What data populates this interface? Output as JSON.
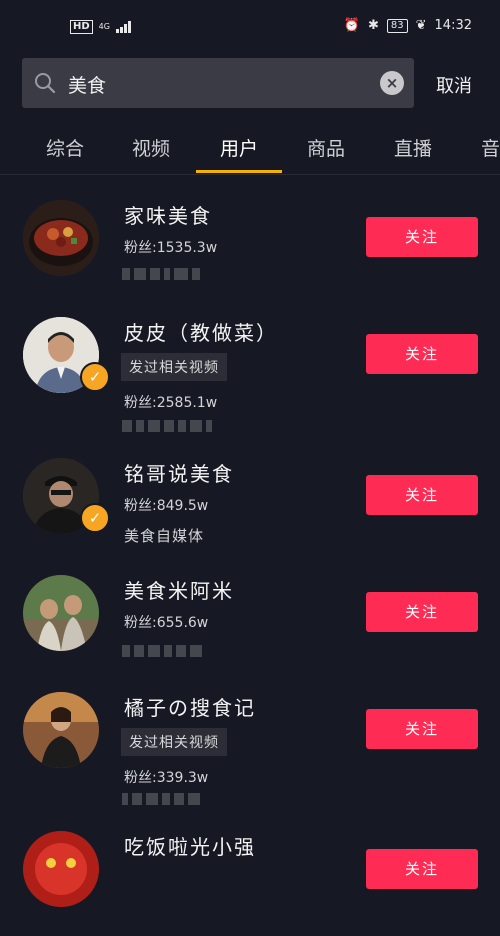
{
  "status": {
    "net_label": "HD",
    "signal": "4G",
    "time": "14:32",
    "battery": "83"
  },
  "search": {
    "query": "美食",
    "clear_symbol": "×",
    "cancel_label": "取消"
  },
  "tabs": [
    {
      "label": "综合"
    },
    {
      "label": "视频"
    },
    {
      "label": "用户"
    },
    {
      "label": "商品"
    },
    {
      "label": "直播"
    },
    {
      "label": "音"
    }
  ],
  "active_tab": "用户",
  "users": [
    {
      "name": "家味美食",
      "fans": "粉丝:1535.3w",
      "follow": "关注",
      "verified": false
    },
    {
      "name": "皮皮（教做菜）",
      "tag": "发过相关视频",
      "fans": "粉丝:2585.1w",
      "follow": "关注",
      "verified": true
    },
    {
      "name": "铭哥说美食",
      "fans": "粉丝:849.5w",
      "sub": "美食自媒体",
      "follow": "关注",
      "verified": true
    },
    {
      "name": "美食米阿米",
      "fans": "粉丝:655.6w",
      "follow": "关注",
      "verified": false
    },
    {
      "name": "橘子の搜食记",
      "tag": "发过相关视频",
      "fans": "粉丝:339.3w",
      "follow": "关注",
      "verified": false
    },
    {
      "name": "吃饭啦光小强",
      "follow": "关注",
      "verified": false
    }
  ],
  "colors": {
    "background": "#161823",
    "accent": "#fe2c55",
    "tab_indicator": "#f5b300",
    "verified": "#f6a623"
  }
}
